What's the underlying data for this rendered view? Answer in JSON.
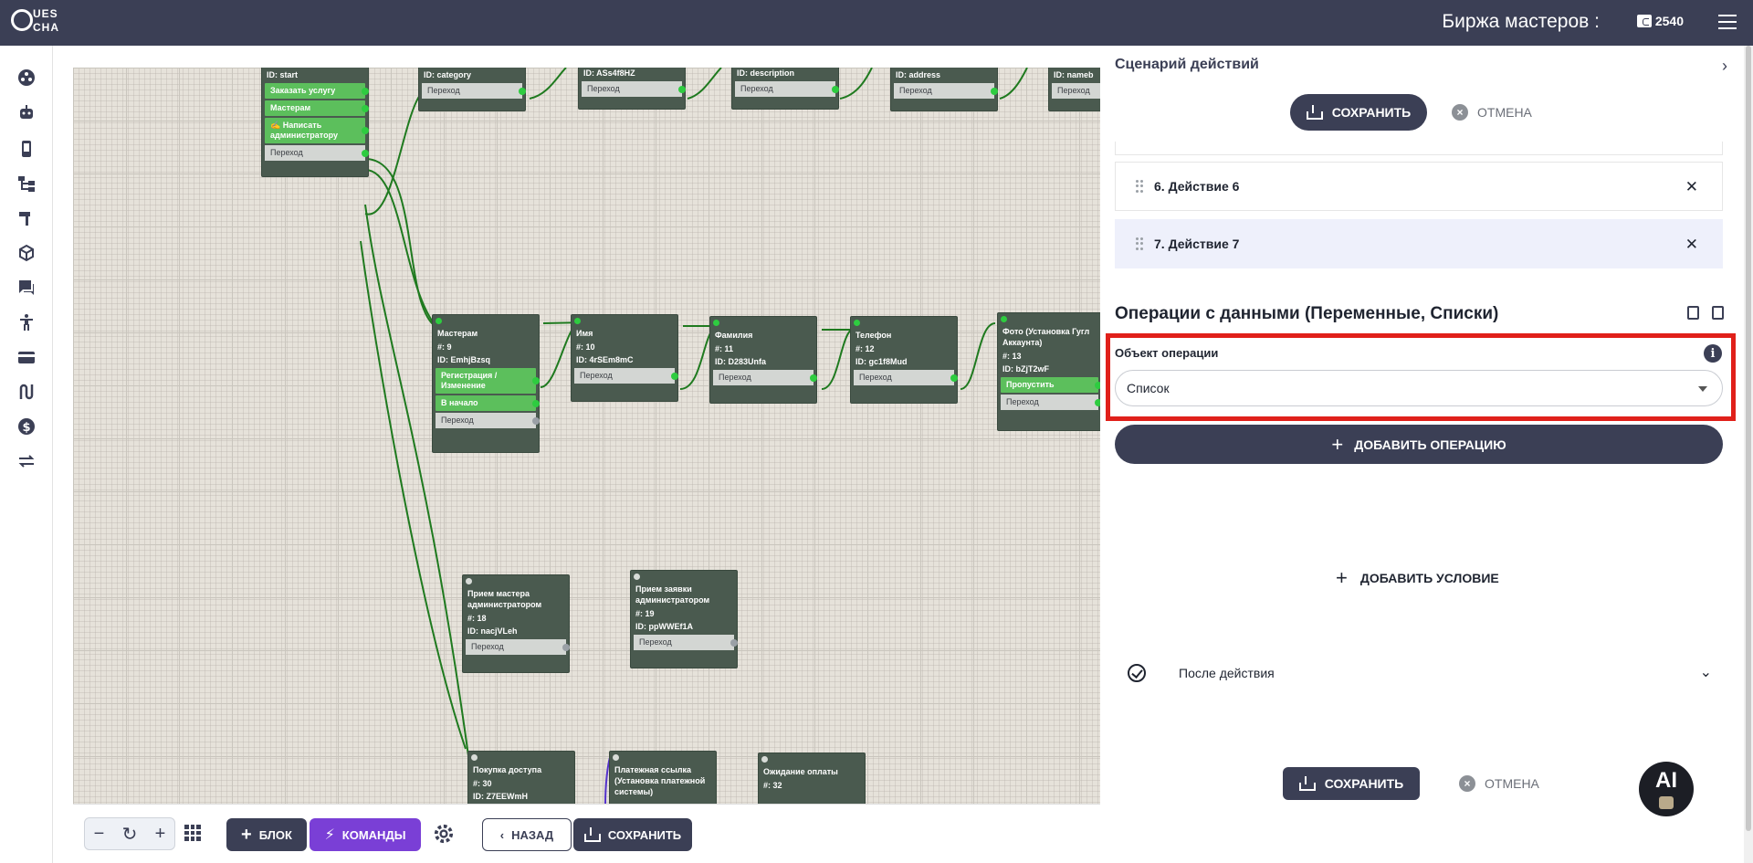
{
  "header": {
    "title": "Биржа мастеров :",
    "balance": "2540",
    "logo_line1": "UES",
    "logo_line2": "CHA"
  },
  "sidebar": {
    "icons": [
      "bot-group-icon",
      "robot-icon",
      "phone-icon",
      "hierarchy-icon",
      "hammer-icon",
      "cube-icon",
      "chat-icon",
      "person-icon",
      "card-icon",
      "route-icon",
      "dollar-icon",
      "swap-icon"
    ]
  },
  "canvas": {
    "nodes": {
      "start": {
        "id": "ID: start",
        "b1": "Заказать услугу",
        "b2": "Мастерам",
        "b3": "✍️ Написать администратору",
        "t": "Переход"
      },
      "category": {
        "id": "ID: category",
        "t": "Переход"
      },
      "name_top": {
        "id": "ID: ASs4f8HZ",
        "t": "Переход"
      },
      "description": {
        "id": "ID: description",
        "t": "Переход"
      },
      "address": {
        "id": "ID: address",
        "t": "Переход"
      },
      "nameb": {
        "id": "ID: nameb",
        "t": "Переход"
      },
      "masters": {
        "title": "Мастерам",
        "num": "#: 9",
        "id": "ID: EmhjBzsq",
        "b1": "Регистрация / Изменение",
        "b2": "В начало",
        "t": "Переход"
      },
      "imya": {
        "title": "Имя",
        "num": "#: 10",
        "id": "ID: 4rSEm8mC",
        "t": "Переход"
      },
      "familiya": {
        "title": "Фамилия",
        "num": "#: 11",
        "id": "ID: D283Unfa",
        "t": "Переход"
      },
      "telefon": {
        "title": "Телефон",
        "num": "#: 12",
        "id": "ID: gc1f8Mud",
        "t": "Переход"
      },
      "foto": {
        "title": "Фото (Установка Гугл Аккаунта)",
        "num": "#: 13",
        "id": "ID: bZjT2wF",
        "b1": "Пропустить",
        "t": "Переход"
      },
      "priem_mastera": {
        "title": "Прием мастера администратором",
        "num": "#: 18",
        "id": "ID: nacjVLeh",
        "t": "Переход"
      },
      "priem_zayavki": {
        "title": "Прием заявки администратором",
        "num": "#: 19",
        "id": "ID: ppWWEf1A",
        "t": "Переход"
      },
      "pokupka": {
        "title": "Покупка доступа",
        "num": "#: 30",
        "id": "ID: Z7EEWmH"
      },
      "platezh": {
        "title": "Платежная ссылка (Установка платежной системы)"
      },
      "ozhidanie": {
        "title": "Ожидание оплаты",
        "num": "#: 32"
      }
    }
  },
  "toolbar": {
    "block_label": "БЛОК",
    "commands_label": "КОМАНДЫ",
    "back_label": "НАЗАД",
    "save_label": "СОХРАНИТЬ"
  },
  "panel": {
    "title": "Сценарий действий",
    "save_label": "СОХРАНИТЬ",
    "cancel_label": "ОТМЕНА",
    "actions": [
      "6. Действие 6",
      "7. Действие 7"
    ],
    "section_title": "Операции с данными (Переменные, Списки)",
    "object_label": "Объект операции",
    "object_value": "Список",
    "add_operation": "ДОБАВИТЬ ОПЕРАЦИЮ",
    "add_condition": "ДОБАВИТЬ УСЛОВИЕ",
    "after_action": "После действия",
    "bottom_save": "СОХРАНИТЬ",
    "bottom_cancel": "ОТМЕНА"
  },
  "ai_badge": "AI",
  "colors": {
    "header_bg": "#3b3f55",
    "node_bg": "#4a5a4f",
    "node_button_green": "#5cbf5c",
    "connector": "#2ecc40",
    "commands_purple": "#7a3fd6",
    "highlight_red": "#e0201a"
  }
}
